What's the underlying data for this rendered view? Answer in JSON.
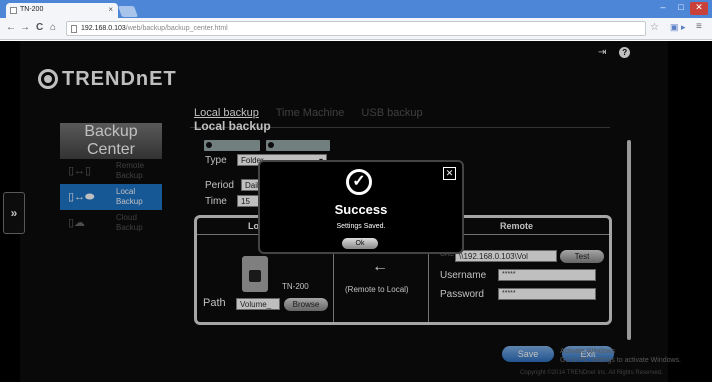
{
  "browser": {
    "tab_title": "TN-200",
    "tab_close": "×",
    "url_host": "192.168.0.103",
    "url_path": "/web/backup/backup_center.html",
    "back_glyph": "←",
    "forward_glyph": "→",
    "reload_glyph": "C",
    "home_glyph": "⌂",
    "star_glyph": "☆",
    "ext_glyph": "▣ ▸",
    "menu_glyph": "≡",
    "minimize_glyph": "–",
    "restore_glyph": "□",
    "close_glyph": "✕"
  },
  "header": {
    "logout_glyph": "⇥",
    "help_glyph": "?",
    "logo_text": "TRENDnET"
  },
  "sidebar": {
    "title_line1": "Backup",
    "title_line2": "Center",
    "expand_glyph": "»",
    "items": [
      {
        "line1": "Remote",
        "line2": "Backup",
        "icon": "remote-backup-icon",
        "glyph": "▯↔▯",
        "active": false
      },
      {
        "line1": "Local",
        "line2": "Backup",
        "icon": "local-backup-icon",
        "glyph": "▯↔⬬",
        "active": true
      },
      {
        "line1": "Cloud",
        "line2": "Backup",
        "icon": "cloud-backup-icon",
        "glyph": "▯☁",
        "active": false
      }
    ]
  },
  "tabs": [
    {
      "label": "Local backup",
      "active": true
    },
    {
      "label": "Time Machine",
      "active": false
    },
    {
      "label": "USB backup",
      "active": false
    }
  ],
  "main": {
    "section_title": "Local backup",
    "type_label": "Type",
    "type_value": "Folder",
    "period_label": "Period",
    "period_value": "Dail",
    "time_label": "Time",
    "time_value": "15",
    "dropdown_glyph": "▾",
    "local_header": "Local",
    "remote_header": "Remote",
    "device_name": "TN-200",
    "path_label": "Path",
    "path_value": "Volume_",
    "browse_label": "Browse",
    "direction_glyph": "←",
    "direction_label": "(Remote to Local)",
    "remote_path_prefix": "URL",
    "remote_path_value": "\\\\192.168.0.103\\Vol",
    "test_label": "Test",
    "username_label": "Username",
    "username_value": "*****",
    "password_label": "Password",
    "password_value": "*****",
    "save_label": "Save",
    "exit_label": "Exit"
  },
  "watermark": {
    "line1": "Activate Windows",
    "line2": "Go to PC settings to activate Windows."
  },
  "copyright": "Copyright ©2014 TRENDnet Inc. All Rights Reserved.",
  "modal": {
    "close_glyph": "✕",
    "check_glyph": "✓",
    "title": "Success",
    "message": "Settings Saved.",
    "ok_label": "Ok"
  }
}
